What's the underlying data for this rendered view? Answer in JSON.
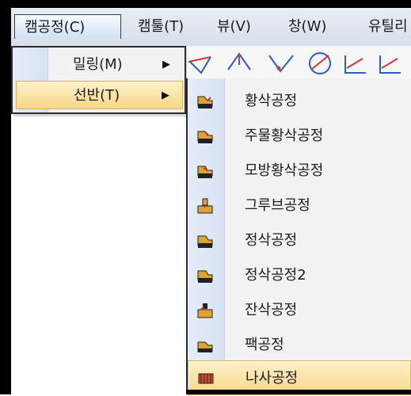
{
  "menubar": {
    "items": [
      {
        "label": "캠공정(C)",
        "active": true
      },
      {
        "label": "캠툴(T)"
      },
      {
        "label": "뷰(V)"
      },
      {
        "label": "창(W)"
      },
      {
        "label": "유틸리"
      }
    ]
  },
  "dropdown": {
    "items": [
      {
        "label": "밀링(M)",
        "submenu_arrow": "▶"
      },
      {
        "label": "선반(T)",
        "submenu_arrow": "▶",
        "selected": true
      }
    ]
  },
  "submenu": {
    "items": [
      {
        "label": "황삭공정",
        "icon": "rough-turning-icon"
      },
      {
        "label": "주물황삭공정",
        "icon": "casting-rough-turning-icon"
      },
      {
        "label": "모방황삭공정",
        "icon": "copy-rough-turning-icon"
      },
      {
        "label": "그루브공정",
        "icon": "groove-icon"
      },
      {
        "label": "정삭공정",
        "icon": "finish-turning-icon"
      },
      {
        "label": "정삭공정2",
        "icon": "finish-turning-2-icon"
      },
      {
        "label": "잔삭공정",
        "icon": "rest-machining-icon"
      },
      {
        "label": "팩공정",
        "icon": "pack-process-icon"
      },
      {
        "label": "나사공정",
        "icon": "thread-process-icon",
        "selected": true
      }
    ]
  },
  "toolbar": {
    "icons": [
      "tool-1-icon",
      "tool-2-icon",
      "tool-3-icon",
      "tool-4-icon",
      "tool-5-icon",
      "tool-6-icon"
    ]
  }
}
